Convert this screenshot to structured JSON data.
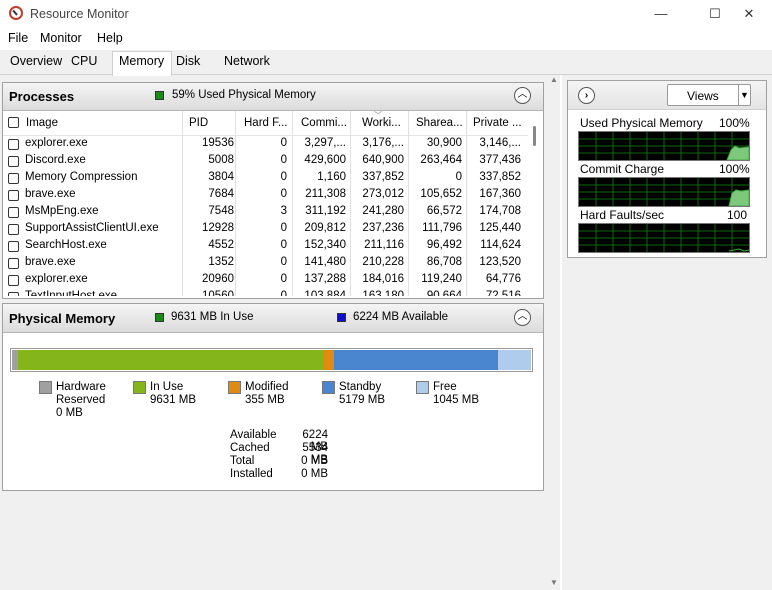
{
  "window": {
    "title": "Resource Monitor",
    "controls": {
      "minimize": "—",
      "maximize": "☐",
      "close": "✕"
    }
  },
  "menu": [
    "File",
    "Monitor",
    "Help"
  ],
  "tabs": [
    {
      "label": "Overview",
      "active": false
    },
    {
      "label": "CPU",
      "active": false
    },
    {
      "label": "Memory",
      "active": true
    },
    {
      "label": "Disk",
      "active": false
    },
    {
      "label": "Network",
      "active": false
    }
  ],
  "processes": {
    "title": "Processes",
    "indicator_color": "#1a8a1a",
    "indicator_text": "59% Used Physical Memory",
    "columns": [
      "Image",
      "PID",
      "Hard F...",
      "Commi...",
      "Worki...",
      "Sharea...",
      "Private ..."
    ],
    "rows": [
      [
        "explorer.exe",
        "19536",
        "0",
        "3,297,...",
        "3,176,...",
        "30,900",
        "3,146,..."
      ],
      [
        "Discord.exe",
        "5008",
        "0",
        "429,600",
        "640,900",
        "263,464",
        "377,436"
      ],
      [
        "Memory Compression",
        "3804",
        "0",
        "1,160",
        "337,852",
        "0",
        "337,852"
      ],
      [
        "brave.exe",
        "7684",
        "0",
        "211,308",
        "273,012",
        "105,652",
        "167,360"
      ],
      [
        "MsMpEng.exe",
        "7548",
        "3",
        "311,192",
        "241,280",
        "66,572",
        "174,708"
      ],
      [
        "SupportAssistClientUI.exe",
        "12928",
        "0",
        "209,812",
        "237,236",
        "111,796",
        "125,440"
      ],
      [
        "SearchHost.exe",
        "4552",
        "0",
        "152,340",
        "211,116",
        "96,492",
        "114,624"
      ],
      [
        "brave.exe",
        "1352",
        "0",
        "141,480",
        "210,228",
        "86,708",
        "123,520"
      ],
      [
        "explorer.exe",
        "20960",
        "0",
        "137,288",
        "184,016",
        "119,240",
        "64,776"
      ],
      [
        "TextInputHost.exe",
        "10560",
        "0",
        "103,884",
        "163,180",
        "90,664",
        "72,516"
      ]
    ]
  },
  "physical_memory": {
    "title": "Physical Memory",
    "in_use_text": "9631 MB In Use",
    "available_text": "6224 MB Available",
    "in_use_color": "#1a8a1a",
    "available_color": "#1010c8",
    "bar": {
      "reserved_mb": 0,
      "in_use_mb": 9631,
      "modified_mb": 355,
      "standby_mb": 5179,
      "free_mb": 1045,
      "colors": {
        "reserved": "#a0a0a0",
        "in_use": "#84b51a",
        "modified": "#e08a10",
        "standby": "#4a86d0",
        "free": "#b0ccec"
      }
    },
    "legend": [
      {
        "key": "reserved",
        "label1": "Hardware",
        "label2": "Reserved",
        "value": "0 MB",
        "color": "#a0a0a0"
      },
      {
        "key": "in_use",
        "label1": "In Use",
        "label2": "",
        "value": "9631 MB",
        "color": "#84b51a"
      },
      {
        "key": "modified",
        "label1": "Modified",
        "label2": "",
        "value": "355 MB",
        "color": "#e08a10"
      },
      {
        "key": "standby",
        "label1": "Standby",
        "label2": "",
        "value": "5179 MB",
        "color": "#4a86d0"
      },
      {
        "key": "free",
        "label1": "Free",
        "label2": "",
        "value": "1045 MB",
        "color": "#b0ccec"
      }
    ],
    "stats": [
      {
        "label": "Available",
        "value": "6224 MB"
      },
      {
        "label": "Cached",
        "value": "5534 MB"
      },
      {
        "label": "Total",
        "value": "0 MB"
      },
      {
        "label": "Installed",
        "value": "0 MB"
      }
    ]
  },
  "right_panel": {
    "views_label": "Views",
    "graphs": [
      {
        "label": "Used Physical Memory",
        "value": "100%"
      },
      {
        "label": "Commit Charge",
        "value": "100%"
      },
      {
        "label": "Hard Faults/sec",
        "value": "100"
      }
    ]
  }
}
